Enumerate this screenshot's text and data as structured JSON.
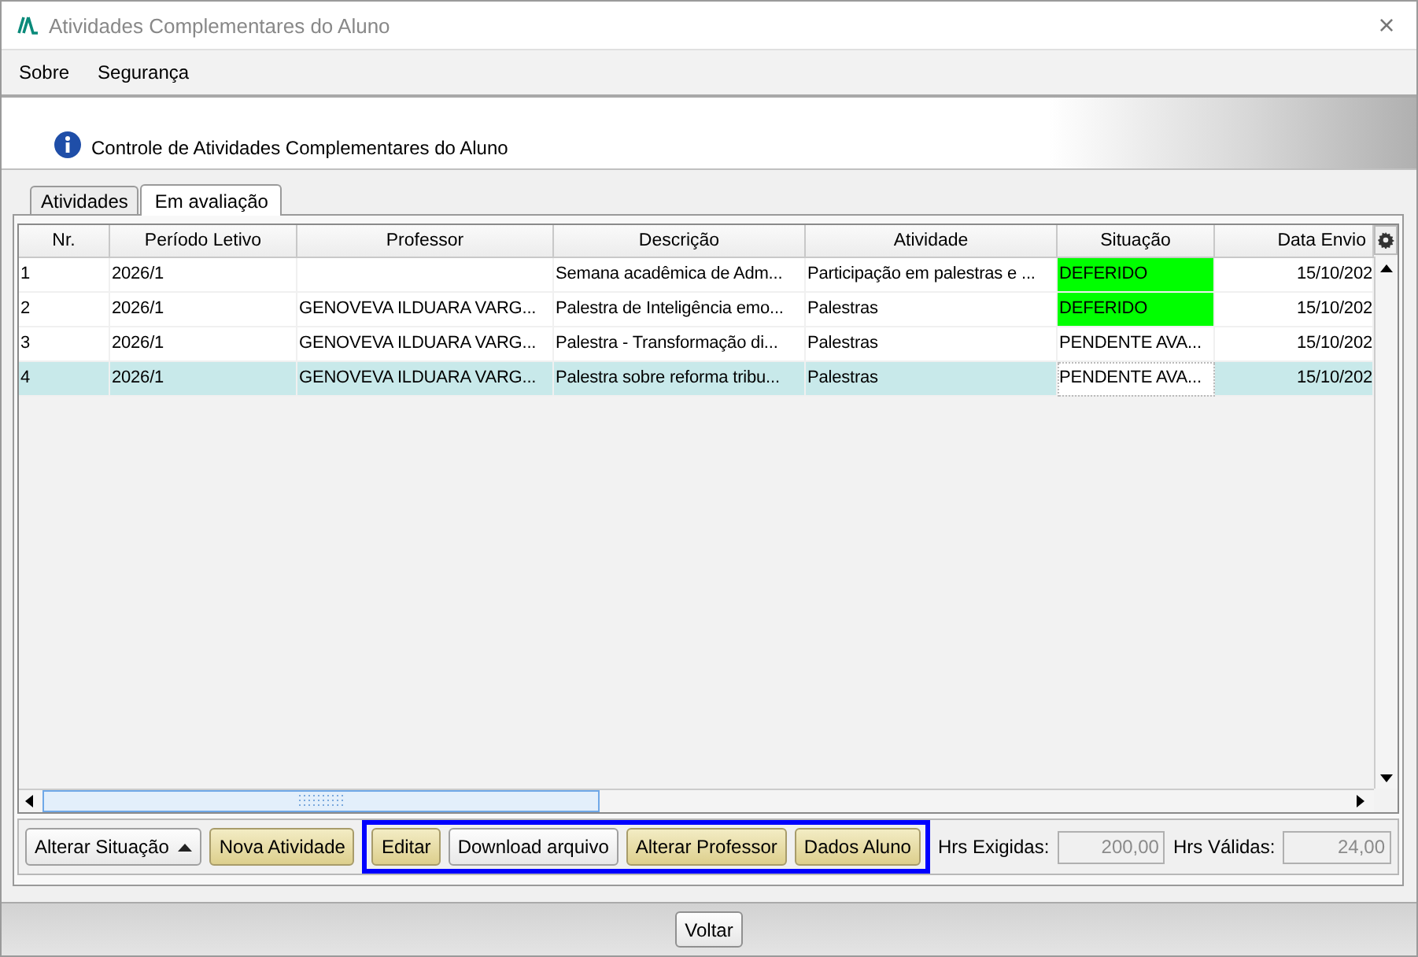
{
  "window": {
    "title": "Atividades Complementares do Aluno",
    "close": "×"
  },
  "menu": [
    "Sobre",
    "Segurança"
  ],
  "header": {
    "text": "Controle de Atividades Complementares do Aluno"
  },
  "tabs": [
    {
      "label": "Atividades",
      "selected": false
    },
    {
      "label": "Em avaliação",
      "selected": true
    }
  ],
  "table": {
    "columns": [
      "Nr.",
      "Período Letivo",
      "Professor",
      "Descrição",
      "Atividade",
      "Situação",
      "Data Envio"
    ],
    "rows": [
      {
        "nr": "1",
        "periodo": "2026/1",
        "professor": "",
        "descricao": "Semana acadêmica de Adm...",
        "atividade": "Participação em palestras e ...",
        "situacao": {
          "text": "DEFERIDO",
          "color": "#00ff00"
        },
        "data_envio": "15/10/202",
        "selected": false,
        "focused_cell": false
      },
      {
        "nr": "2",
        "periodo": "2026/1",
        "professor": "GENOVEVA ILDUARA VARG...",
        "descricao": "Palestra de Inteligência emo...",
        "atividade": "Palestras",
        "situacao": {
          "text": "DEFERIDO",
          "color": "#00ff00"
        },
        "data_envio": "15/10/202",
        "selected": false,
        "focused_cell": false
      },
      {
        "nr": "3",
        "periodo": "2026/1",
        "professor": "GENOVEVA ILDUARA VARG...",
        "descricao": "Palestra - Transformação di...",
        "atividade": "Palestras",
        "situacao": {
          "text": "PENDENTE AVA..."
        },
        "data_envio": "15/10/202",
        "selected": false,
        "focused_cell": false
      },
      {
        "nr": "4",
        "periodo": "2026/1",
        "professor": "GENOVEVA ILDUARA VARG...",
        "descricao": "Palestra sobre reforma tribu...",
        "atividade": "Palestras",
        "situacao": {
          "text": "PENDENTE AVA..."
        },
        "data_envio": "15/10/202",
        "selected": true,
        "focused_cell": true
      }
    ]
  },
  "actions": [
    {
      "label": "Alterar Situação",
      "kind": "dropdown"
    },
    {
      "label": "Nova Atividade",
      "kind": "accent"
    }
  ],
  "highlighted_actions": [
    {
      "label": "Editar",
      "kind": "accent"
    },
    {
      "label": "Download arquivo",
      "kind": "plain"
    },
    {
      "label": "Alterar Professor",
      "kind": "accent"
    },
    {
      "label": "Dados Aluno",
      "kind": "accent"
    }
  ],
  "fields": [
    {
      "label": "Hrs Exigidas:",
      "value": "200,00",
      "disabled": true
    },
    {
      "label": "Hrs Válidas:",
      "value": "24,00",
      "disabled": true
    }
  ],
  "footer_button": "Voltar"
}
